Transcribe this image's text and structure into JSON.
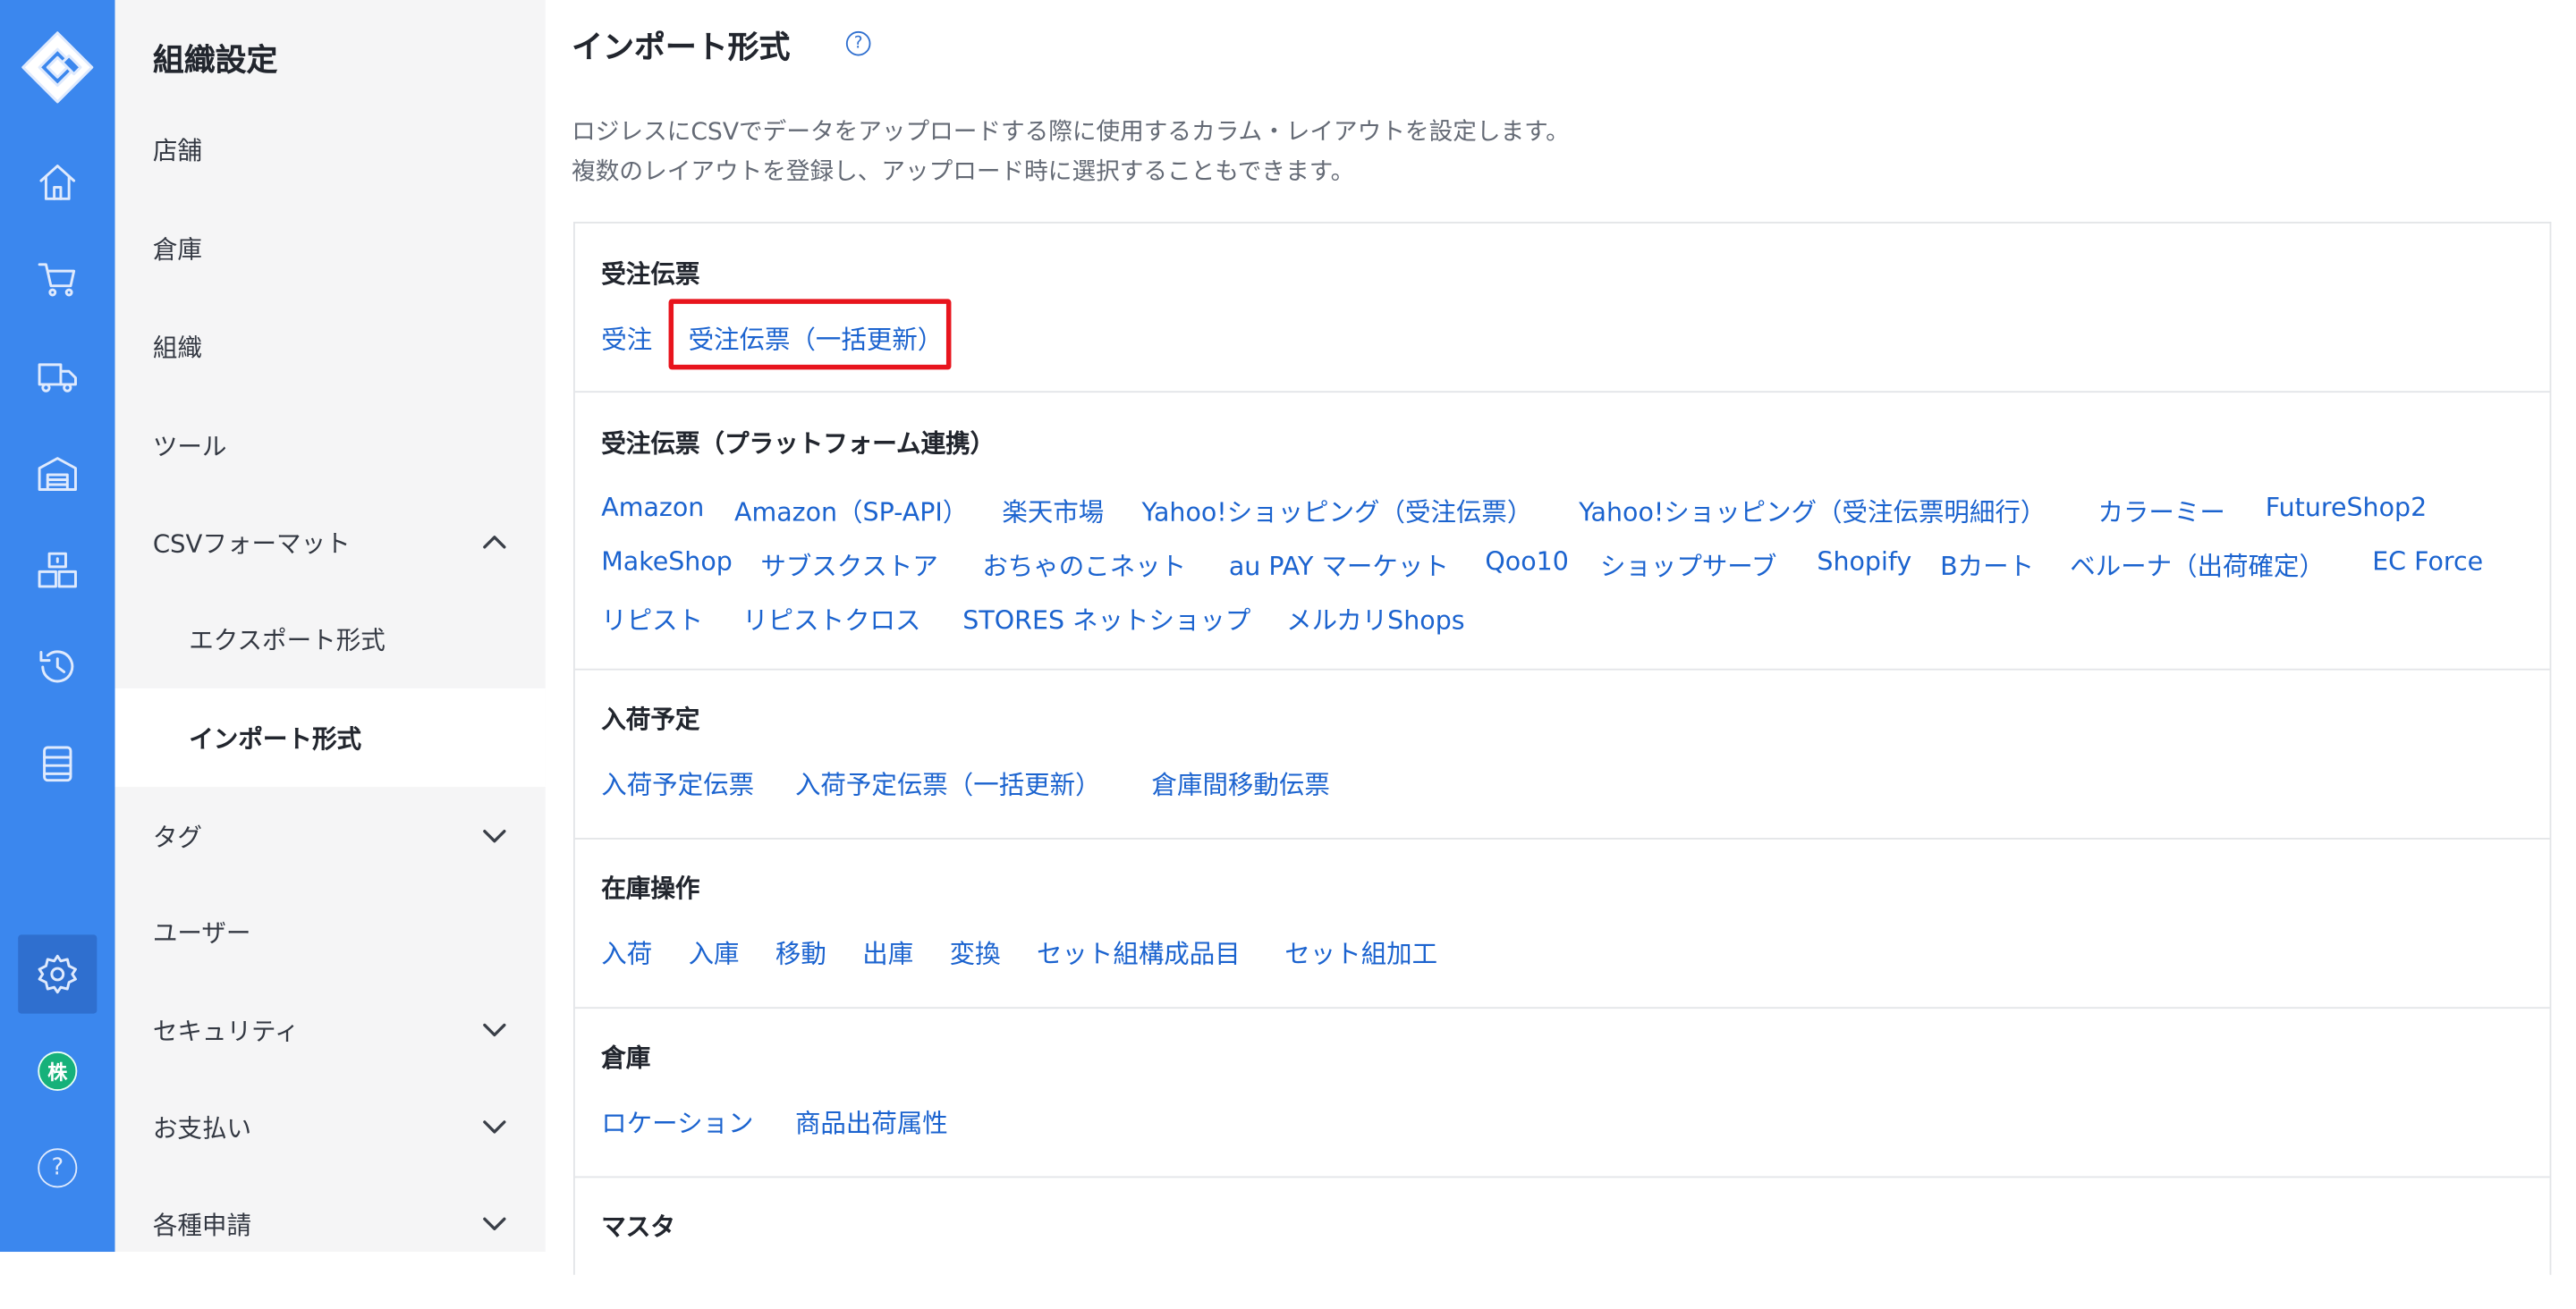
{
  "nav": {
    "title": "組織設定",
    "items": [
      {
        "label": "店舗"
      },
      {
        "label": "倉庫"
      },
      {
        "label": "組織"
      },
      {
        "label": "ツール"
      },
      {
        "label": "CSVフォーマット"
      },
      {
        "label": "エクスポート形式"
      },
      {
        "label": "インポート形式"
      },
      {
        "label": "タグ"
      },
      {
        "label": "ユーザー"
      },
      {
        "label": "セキュリティ"
      },
      {
        "label": "お支払い"
      },
      {
        "label": "各種申請"
      }
    ]
  },
  "rail": {
    "badge": "株",
    "help": "?"
  },
  "page": {
    "title": "インポート形式",
    "help": "?",
    "desc1": "ロジレスにCSVでデータをアップロードする際に使用するカラム・レイアウトを設定します。",
    "desc2": "複数のレイアウトを登録し、アップロード時に選択することもできます。"
  },
  "sections": [
    {
      "title": "受注伝票",
      "links": [
        "受注",
        "受注伝票（一括更新）"
      ]
    },
    {
      "title": "受注伝票（プラットフォーム連携）",
      "links": [
        "Amazon",
        "Amazon（SP-API）",
        "楽天市場",
        "Yahoo!ショッピング（受注伝票）",
        "Yahoo!ショッピング（受注伝票明細行）",
        "カラーミー",
        "FutureShop2",
        "MakeShop",
        "サブスクストア",
        "おちゃのこネット",
        "au PAY マーケット",
        "Qoo10",
        "ショップサーブ",
        "Shopify",
        "Bカート",
        "ベルーナ（出荷確定）",
        "EC Force",
        "リピスト",
        "リピストクロス",
        "STORES ネットショップ",
        "メルカリShops"
      ]
    },
    {
      "title": "入荷予定",
      "links": [
        "入荷予定伝票",
        "入荷予定伝票（一括更新）",
        "倉庫間移動伝票"
      ]
    },
    {
      "title": "在庫操作",
      "links": [
        "入荷",
        "入庫",
        "移動",
        "出庫",
        "変換",
        "セット組構成品目",
        "セット組加工"
      ]
    },
    {
      "title": "倉庫",
      "links": [
        "ロケーション",
        "商品出荷属性"
      ]
    },
    {
      "title": "マスタ",
      "links": []
    }
  ],
  "colors": {
    "rail": "#3b87ee",
    "link": "#1b63cf",
    "highlight": "#e8141d",
    "badge": "#16b17a"
  }
}
